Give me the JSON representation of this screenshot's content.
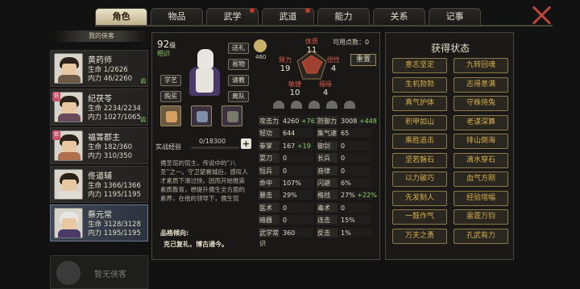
{
  "tabs": [
    {
      "label": "角色",
      "active": true,
      "dot": false
    },
    {
      "label": "物品",
      "active": false,
      "dot": false
    },
    {
      "label": "武学",
      "active": false,
      "dot": true
    },
    {
      "label": "武道",
      "active": false,
      "dot": true
    },
    {
      "label": "能力",
      "active": false,
      "dot": false
    },
    {
      "label": "关系",
      "active": false,
      "dot": false
    },
    {
      "label": "记事",
      "active": false,
      "dot": false
    }
  ],
  "sidebar": {
    "header": "我的侠客",
    "cards": [
      {
        "name": "黄药师",
        "life_label": "生命",
        "life": "1/2626",
        "neili_label": "内力",
        "neili": "46/2260",
        "tiao": "调",
        "badge": ""
      },
      {
        "name": "纪茯苓",
        "life_label": "生命",
        "life": "2234/2234",
        "neili_label": "内力",
        "neili": "1027/1065",
        "tiao": "调",
        "badge": "侣"
      },
      {
        "name": "福箐郡主",
        "life_label": "生命",
        "life": "182/360",
        "neili_label": "内力",
        "neili": "310/350",
        "tiao": "",
        "badge": "侣"
      },
      {
        "name": "佟道辅",
        "life_label": "生命",
        "life": "1366/1366",
        "neili_label": "内力",
        "neili": "1195/1195",
        "tiao": "",
        "badge": ""
      },
      {
        "name": "蔡元常",
        "life_label": "生命",
        "life": "3128/3128",
        "neili_label": "内力",
        "neili": "1195/1195",
        "tiao": "",
        "badge": ""
      }
    ],
    "empty": "暂无侠客"
  },
  "char": {
    "level": "92",
    "level_unit": "级",
    "xiang": "相识",
    "buttons": [
      "送礼",
      "易物",
      "请教",
      "离队",
      "学艺",
      "购买"
    ],
    "xp_label": "实战经验",
    "xp": "0/18300",
    "xp_progress": 0,
    "desc": "儒圣馆的馆主，传说中的“八圣”之一。守卫楚襄城后，感叹人才素质下滑过快，因而开始推崇素质教育，想提升儒生全方面的素养，在他的领导下，儒生馆",
    "qx_label": "品格倾向:",
    "qx_value": "克己复礼，博古通今。"
  },
  "attrs": {
    "coin": "460",
    "available_label": "可用点数：",
    "available": "0",
    "reset": "重置",
    "traits": [
      {
        "name": "体质",
        "value": "11"
      },
      {
        "name": "臂力",
        "value": "19"
      },
      {
        "name": "悟性",
        "value": "4"
      },
      {
        "name": "敏捷",
        "value": "10"
      },
      {
        "name": "福缘",
        "value": "4"
      }
    ]
  },
  "stats": [
    {
      "k": "攻击力",
      "v": "4260",
      "bonus": "+761"
    },
    {
      "k": "防御力",
      "v": "3008",
      "bonus": "+448"
    },
    {
      "k": "轻功",
      "v": "644",
      "bonus": ""
    },
    {
      "k": "集气速度",
      "v": "65",
      "bonus": ""
    },
    {
      "k": "拳掌",
      "v": "167",
      "bonus": "+19"
    },
    {
      "k": "御剑",
      "v": "0",
      "bonus": ""
    },
    {
      "k": "耍刀",
      "v": "0",
      "bonus": ""
    },
    {
      "k": "长兵",
      "v": "0",
      "bonus": ""
    },
    {
      "k": "短兵",
      "v": "0",
      "bonus": ""
    },
    {
      "k": "音律",
      "v": "0",
      "bonus": ""
    },
    {
      "k": "命中",
      "v": "107%",
      "bonus": ""
    },
    {
      "k": "闪避",
      "v": "6%",
      "bonus": ""
    },
    {
      "k": "暴击",
      "v": "29%",
      "bonus": ""
    },
    {
      "k": "格挡",
      "v": "27%",
      "bonus": "+22%"
    },
    {
      "k": "医术",
      "v": "0",
      "bonus": ""
    },
    {
      "k": "毒术",
      "v": "0",
      "bonus": ""
    },
    {
      "k": "暗器",
      "v": "0",
      "bonus": ""
    },
    {
      "k": "连击",
      "v": "15%",
      "bonus": ""
    },
    {
      "k": "武学常识",
      "v": "360",
      "bonus": ""
    },
    {
      "k": "反击",
      "v": "1%",
      "bonus": ""
    }
  ],
  "status": {
    "title": "获得状态",
    "items": [
      "意志坚定",
      "九转回魂",
      "生机勃勃",
      "志得意满",
      "真气护体",
      "守株待兔",
      "积甲如山",
      "老谋深算",
      "乘胜追击",
      "排山倒海",
      "坚若磐石",
      "滴水穿石",
      "以力破巧",
      "血气方刚",
      "先发制人",
      "经验增幅",
      "一鼓作气",
      "雷霆万钧",
      "万夫之勇",
      "孔武有力"
    ]
  }
}
